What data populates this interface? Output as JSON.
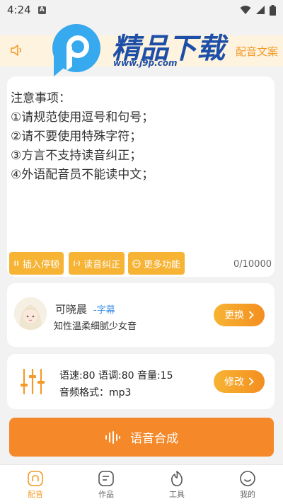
{
  "status_bar": {
    "time": "4:24",
    "notification_icon": "A"
  },
  "banner": {
    "text": "配音文案"
  },
  "logo": {
    "brand": "精品下载",
    "url": "www.j9p.com"
  },
  "editor": {
    "lines": [
      "注意事项：",
      "①请规范使用逗号和句号；",
      "②请不要使用特殊字符；",
      "③方言不支持读音纠正；",
      "④外语配音员不能读中文；"
    ],
    "buttons": {
      "pause": "插入停顿",
      "pronunciation": "读音纠正",
      "more": "更多功能"
    },
    "counter": "0/10000"
  },
  "voice": {
    "name": "可晓晨",
    "tag": "-字幕",
    "description": "知性温柔细腻少女音",
    "change_label": "更换"
  },
  "params": {
    "line1": "语速:80 语调:80 音量:15",
    "line2": "音频格式：mp3",
    "edit_label": "修改"
  },
  "synthesize_label": "语音合成",
  "nav": {
    "items": [
      {
        "label": "配音",
        "icon": "home-icon"
      },
      {
        "label": "作品",
        "icon": "works-icon"
      },
      {
        "label": "工具",
        "icon": "tools-icon"
      },
      {
        "label": "我的",
        "icon": "profile-icon"
      }
    ]
  },
  "colors": {
    "accent": "#f5892a",
    "brand_blue": "#1e4fa8",
    "tag_blue": "#3a8ee6"
  }
}
